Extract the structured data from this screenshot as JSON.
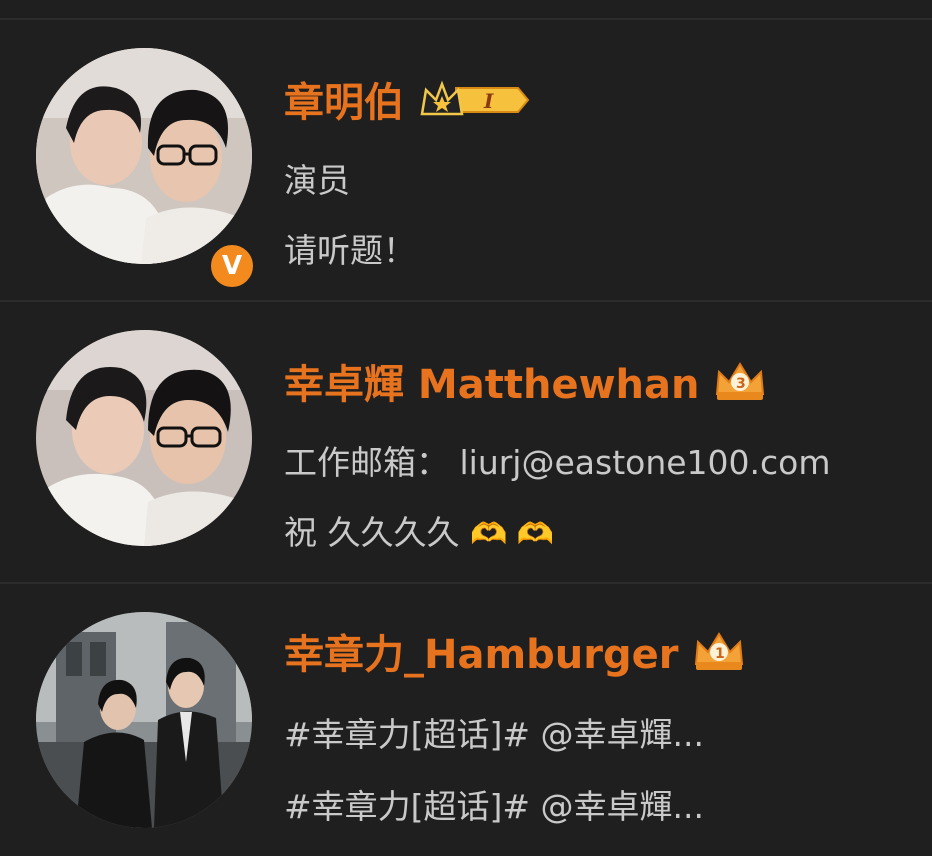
{
  "users": [
    {
      "name": "章明伯",
      "line1": "演员",
      "line2": "请听题！",
      "verified_badge": "V",
      "level_badge_text": "I"
    },
    {
      "name": "幸卓輝 Matthewhan",
      "line1": "工作邮箱： liurj@eastone100.com",
      "line2": "祝 久久久久",
      "emoji": "🫶 🫶",
      "crown_level": "3"
    },
    {
      "name": "幸章力_Hamburger",
      "line1": "#幸章力[超话]#  @幸卓輝...",
      "line2": "#幸章力[超话]#  @幸卓輝...",
      "crown_level": "1"
    }
  ],
  "colors": {
    "background": "#1f1f1f",
    "name": "#e8731f",
    "text": "#c9c9c9",
    "divider": "#2c2c2c",
    "verified": "#f28a1e"
  },
  "icons": [
    "crown-level-badge-icon",
    "verified-v-icon",
    "crown-icon",
    "heart-hands-emoji"
  ]
}
